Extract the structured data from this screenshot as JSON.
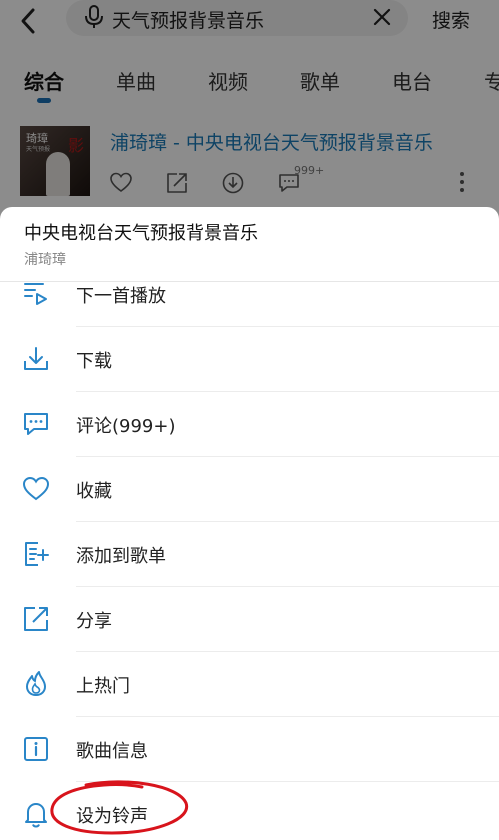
{
  "search": {
    "query": "天气预报背景音乐",
    "submit_label": "搜索"
  },
  "tabs": [
    {
      "label": "综合",
      "active": true
    },
    {
      "label": "单曲"
    },
    {
      "label": "视频"
    },
    {
      "label": "歌单"
    },
    {
      "label": "电台"
    },
    {
      "label": "专"
    }
  ],
  "result": {
    "title": "浦琦璋 - 中央电视台天气预报背景音乐",
    "comment_count": "999+",
    "cover": {
      "name": "琦璋",
      "subtitle": "天气预报"
    }
  },
  "sheet": {
    "title": "中央电视台天气预报背景音乐",
    "artist": "浦琦璋",
    "items": [
      {
        "label": "下一首播放",
        "icon": "play-next-icon"
      },
      {
        "label": "下载",
        "icon": "download-icon"
      },
      {
        "label": "评论(999+)",
        "icon": "comment-icon"
      },
      {
        "label": "收藏",
        "icon": "heart-icon"
      },
      {
        "label": "添加到歌单",
        "icon": "add-to-playlist-icon"
      },
      {
        "label": "分享",
        "icon": "share-icon"
      },
      {
        "label": "上热门",
        "icon": "flame-icon"
      },
      {
        "label": "歌曲信息",
        "icon": "info-icon"
      },
      {
        "label": "设为铃声",
        "icon": "bell-icon"
      }
    ]
  },
  "colors": {
    "accent": "#1a7ab8",
    "icon": "#2a86c8",
    "annotation": "#d8141c"
  }
}
